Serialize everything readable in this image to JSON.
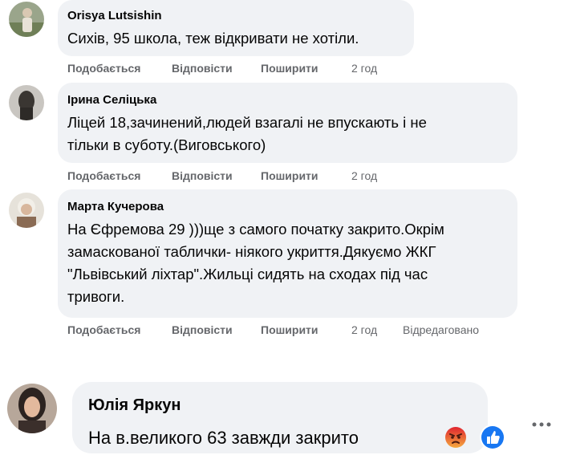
{
  "comments": [
    {
      "author": "Orisya Lutsishin",
      "lines": [
        "Сихів, 95 школа, теж відкривати не хотіли."
      ],
      "actions": {
        "like": "Подобається",
        "reply": "Відповісти",
        "share": "Поширити",
        "time": "2 год"
      }
    },
    {
      "author": "Ірина Селіцька",
      "lines": [
        "Ліцей 18,зачинений,людей взагалі не впускають і не",
        "тільки в суботу.(Виговського)"
      ],
      "actions": {
        "like": "Подобається",
        "reply": "Відповісти",
        "share": "Поширити",
        "time": "2 год"
      }
    },
    {
      "author": "Марта Кучерова",
      "lines": [
        "На Єфремова 29 )))ще з самого початку закрито.Окрім",
        "замаскованої таблички- ніякого укриття.Дякуємо ЖКГ",
        "\"Львівський ліхтар\".Жильці сидять на сходах під час",
        "тривоги."
      ],
      "actions": {
        "like": "Подобається",
        "reply": "Відповісти",
        "share": "Поширити",
        "time": "2 год",
        "edited": "Відредаговано"
      }
    },
    {
      "author": "Юлія Яркун",
      "lines": [
        "На в.великого 63 завжди закрито"
      ],
      "reactions": [
        "angry-icon",
        "like-icon"
      ]
    }
  ],
  "colors": {
    "bubble": "#f0f2f5",
    "meta": "#65676b",
    "like": "#1877f2",
    "angry": "#e9710f"
  }
}
